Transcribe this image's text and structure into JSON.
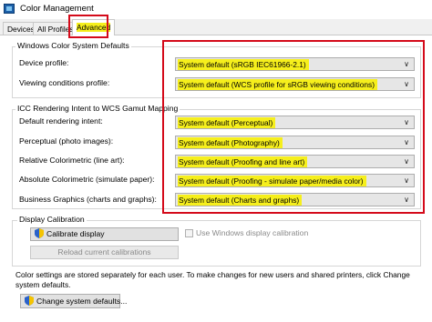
{
  "window": {
    "title": "Color Management"
  },
  "tabs": [
    {
      "label": "Devices"
    },
    {
      "label": "All Profiles"
    },
    {
      "label": "Advanced"
    }
  ],
  "wcs_defaults": {
    "group_label": "Windows Color System Defaults",
    "device_profile_label": "Device profile:",
    "device_profile_value": "System default (sRGB IEC61966-2.1)",
    "viewing_conditions_label": "Viewing conditions profile:",
    "viewing_conditions_value": "System default (WCS profile for sRGB viewing conditions)"
  },
  "icc_mapping": {
    "group_label": "ICC Rendering Intent to WCS Gamut Mapping",
    "rows": [
      {
        "label": "Default rendering intent:",
        "value": "System default (Perceptual)"
      },
      {
        "label": "Perceptual (photo images):",
        "value": "System default (Photography)"
      },
      {
        "label": "Relative Colorimetric (line art):",
        "value": "System default (Proofing and line art)"
      },
      {
        "label": "Absolute Colorimetric (simulate paper):",
        "value": "System default (Proofing - simulate paper/media color)"
      },
      {
        "label": "Business Graphics (charts and graphs):",
        "value": "System default (Charts and graphs)"
      }
    ]
  },
  "display_calibration": {
    "group_label": "Display Calibration",
    "calibrate_button": "Calibrate display",
    "reload_button": "Reload current calibrations",
    "use_windows_calibration_label": "Use Windows display calibration",
    "use_windows_calibration_checked": false
  },
  "footer": {
    "note": "Color settings are stored separately for each user. To make changes for new users and shared printers, click Change system defaults.",
    "change_defaults_button": "Change system defaults..."
  },
  "colors": {
    "highlight": "#f6ef1c",
    "annotation_red": "#d40a1a",
    "shield_blue": "#2a62c9",
    "shield_yellow": "#f5c400"
  }
}
